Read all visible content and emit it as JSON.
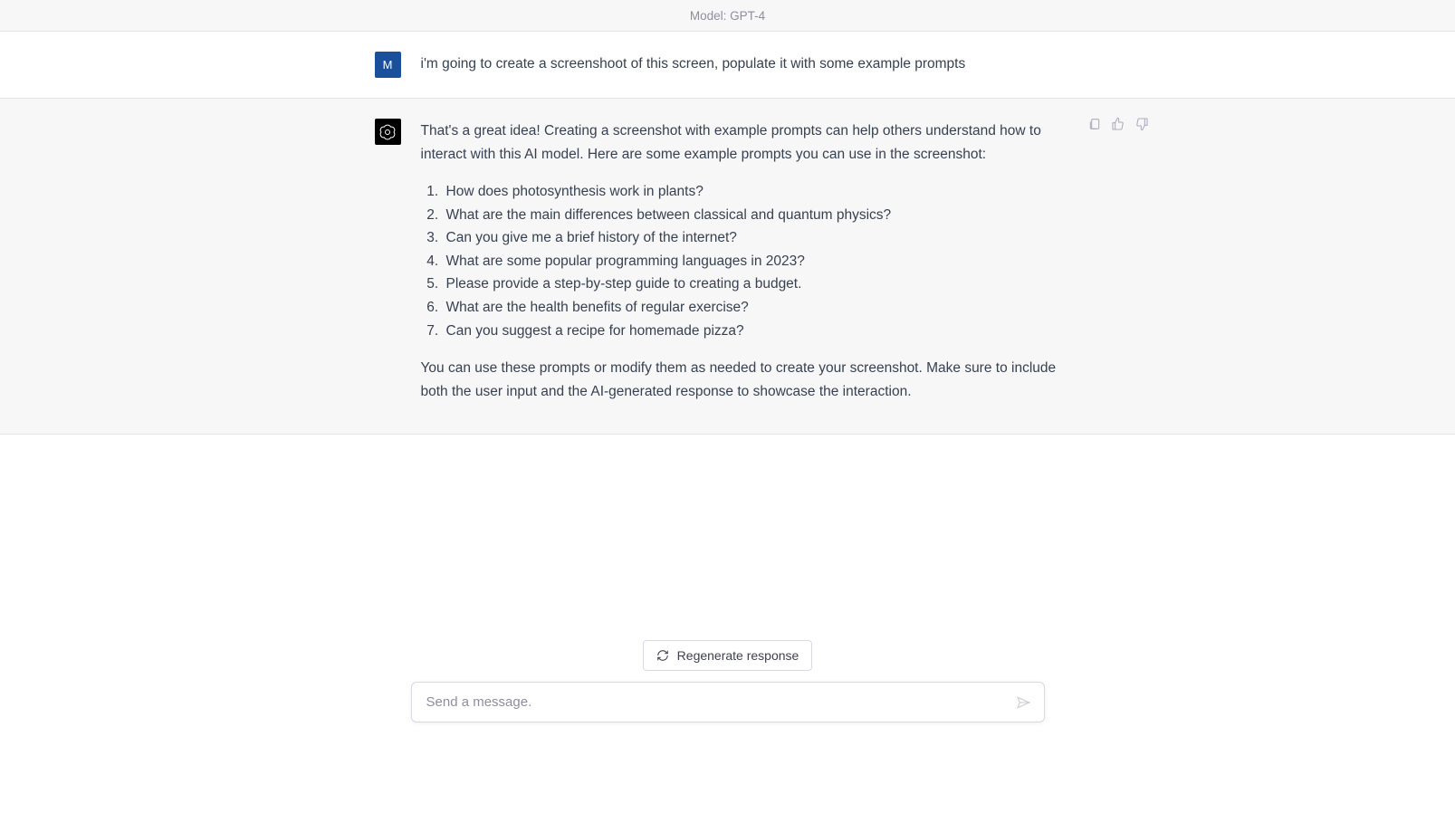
{
  "header": {
    "model_label": "Model: GPT-4"
  },
  "user": {
    "avatar_letter": "M",
    "message": "i'm going to create a screenshoot of this screen, populate it with some example prompts"
  },
  "assistant": {
    "intro": "That's a great idea! Creating a screenshot with example prompts can help others understand how to interact with this AI model. Here are some example prompts you can use in the screenshot:",
    "prompts": [
      "How does photosynthesis work in plants?",
      "What are the main differences between classical and quantum physics?",
      "Can you give me a brief history of the internet?",
      "What are some popular programming languages in 2023?",
      "Please provide a step-by-step guide to creating a budget.",
      "What are the health benefits of regular exercise?",
      "Can you suggest a recipe for homemade pizza?"
    ],
    "outro": "You can use these prompts or modify them as needed to create your screenshot. Make sure to include both the user input and the AI-generated response to showcase the interaction."
  },
  "controls": {
    "regenerate_label": "Regenerate response",
    "input_placeholder": "Send a message."
  }
}
